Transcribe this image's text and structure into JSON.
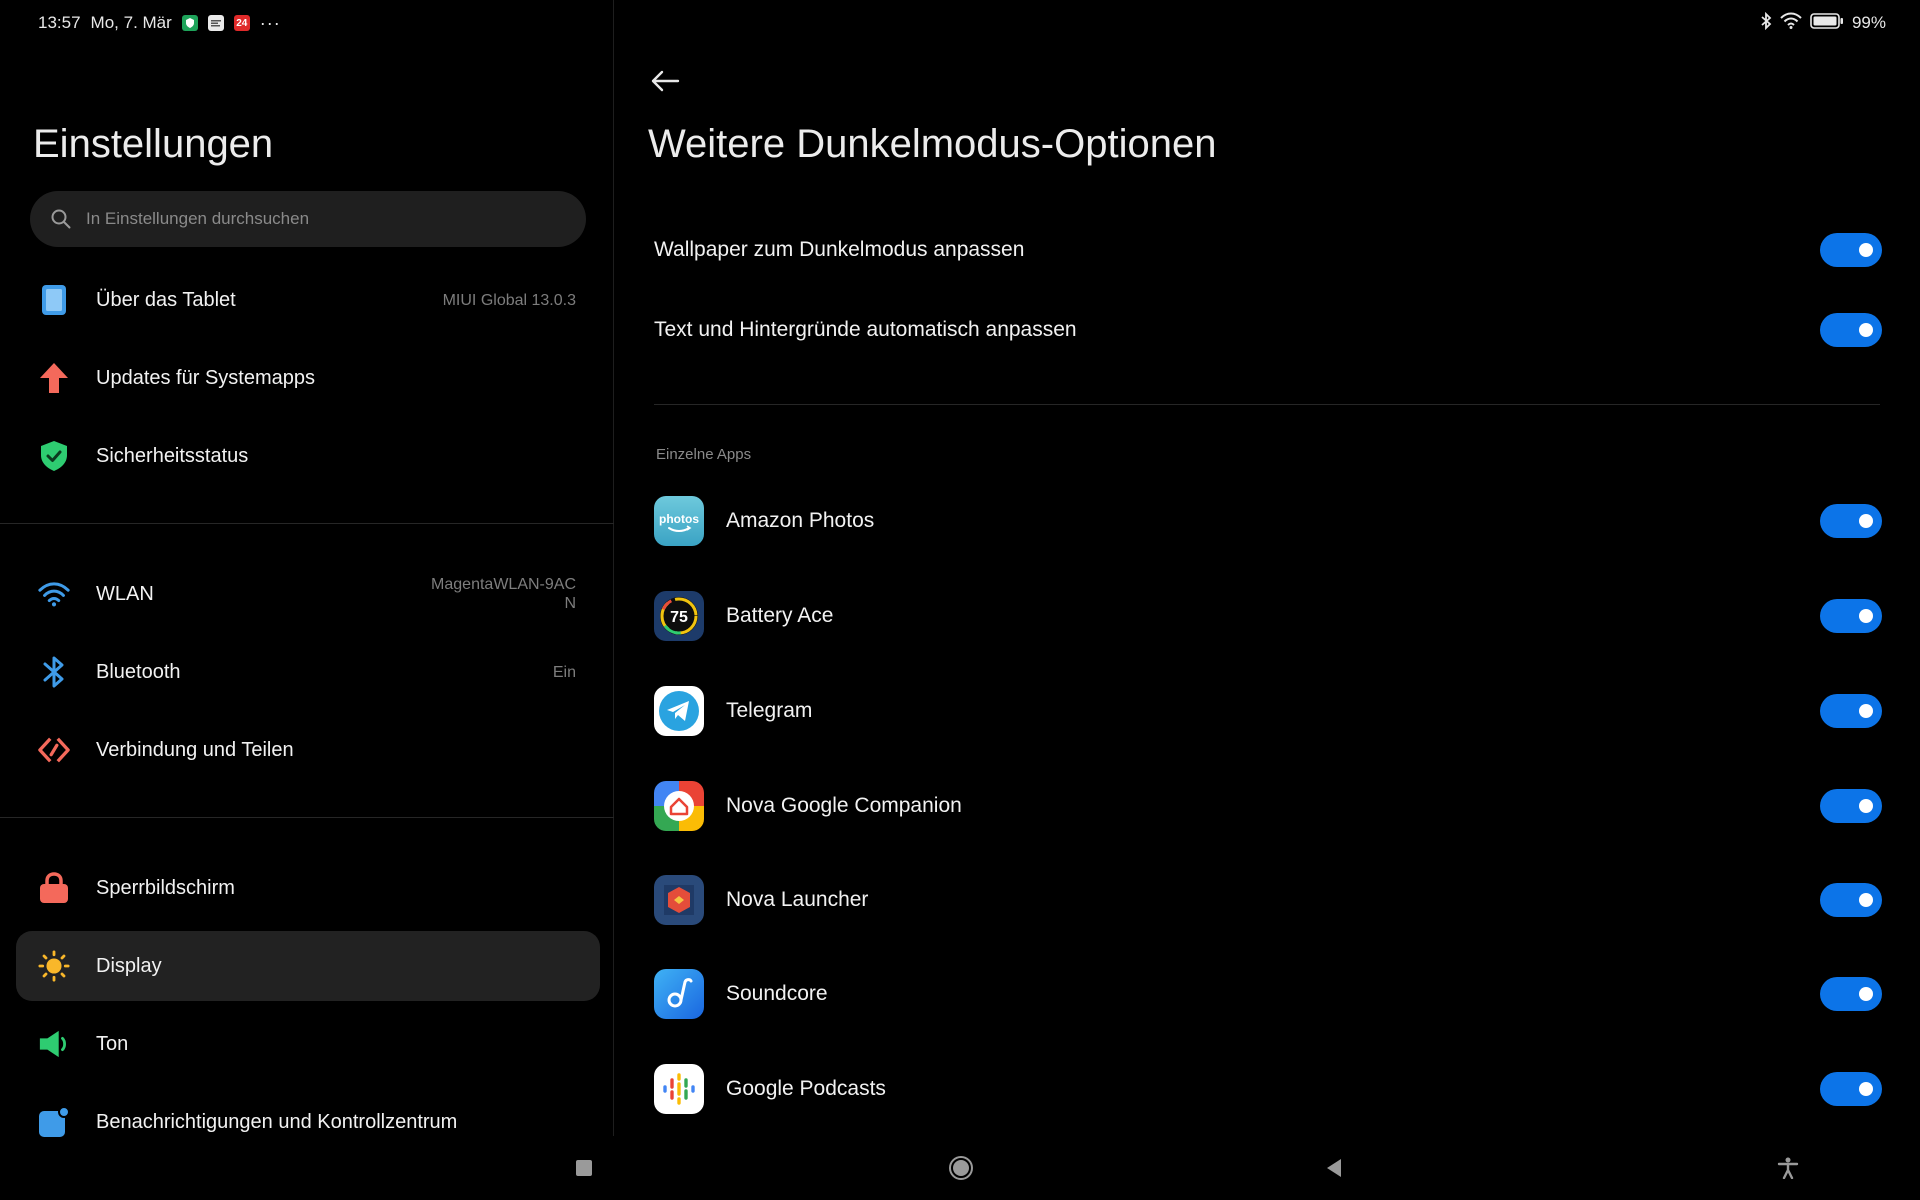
{
  "status_bar": {
    "time": "13:57",
    "date": "Mo, 7. Mär",
    "notif_badge": "24",
    "more": "···",
    "battery": "99%"
  },
  "left": {
    "title": "Einstellungen",
    "search_placeholder": "In Einstellungen durchsuchen",
    "items": [
      {
        "label": "Über das Tablet",
        "value": "MIUI Global 13.0.3",
        "icon": "tablet-icon"
      },
      {
        "label": "Updates für Systemapps",
        "value": "",
        "icon": "update-arrow-icon"
      },
      {
        "label": "Sicherheitsstatus",
        "value": "",
        "icon": "shield-check-icon"
      },
      {
        "label": "WLAN",
        "value": "MagentaWLAN-9AC",
        "value2": "N",
        "icon": "wifi-icon"
      },
      {
        "label": "Bluetooth",
        "value": "Ein",
        "icon": "bluetooth-icon"
      },
      {
        "label": "Verbindung und Teilen",
        "value": "",
        "icon": "connection-share-icon"
      },
      {
        "label": "Sperrbildschirm",
        "value": "",
        "icon": "lock-icon"
      },
      {
        "label": "Display",
        "value": "",
        "icon": "sun-icon"
      },
      {
        "label": "Ton",
        "value": "",
        "icon": "speaker-icon"
      },
      {
        "label": "Benachrichtigungen und Kontrollzentrum",
        "value": "",
        "icon": "notification-icon"
      }
    ]
  },
  "right": {
    "title": "Weitere Dunkelmodus-Optionen",
    "settings": [
      {
        "label": "Wallpaper zum Dunkelmodus anpassen",
        "enabled": true
      },
      {
        "label": "Text und Hintergründe automatisch anpassen",
        "enabled": true
      }
    ],
    "section_label": "Einzelne Apps",
    "apps": [
      {
        "label": "Amazon Photos",
        "enabled": true,
        "icon": "amazon-photos-icon",
        "icon_text": "photos"
      },
      {
        "label": "Battery Ace",
        "enabled": true,
        "icon": "battery-ace-icon",
        "icon_text": "75"
      },
      {
        "label": "Telegram",
        "enabled": true,
        "icon": "telegram-icon"
      },
      {
        "label": "Nova Google Companion",
        "enabled": true,
        "icon": "nova-google-companion-icon"
      },
      {
        "label": "Nova Launcher",
        "enabled": true,
        "icon": "nova-launcher-icon"
      },
      {
        "label": "Soundcore",
        "enabled": true,
        "icon": "soundcore-icon"
      },
      {
        "label": "Google Podcasts",
        "enabled": true,
        "icon": "google-podcasts-icon"
      }
    ]
  },
  "colors": {
    "accent": "#0c74e8",
    "background": "#000000",
    "active_item": "#222222"
  }
}
